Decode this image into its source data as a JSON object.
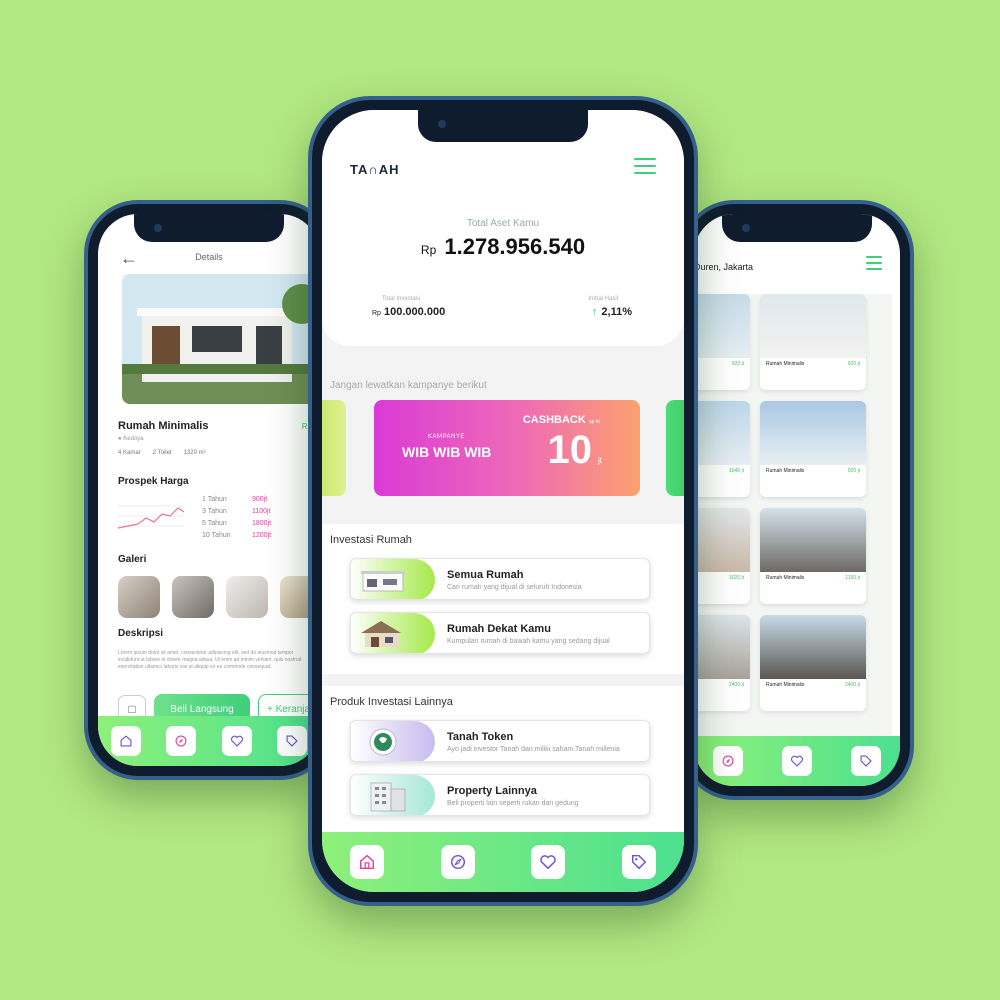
{
  "colors": {
    "background": "#b2e882",
    "accent_green": "#3fcf7a",
    "accent_pink": "#e73f9b",
    "tab_icon": "#6b4fe0"
  },
  "left": {
    "header_title": "Details",
    "property_name": "Rumah Minimalis",
    "price_partial": "Rp",
    "location": "Kedoya",
    "specs": [
      "4 Kamar",
      "2 Toilet",
      "1320 m²"
    ],
    "prospect_title": "Prospek Harga",
    "projection": [
      {
        "year": "1",
        "unit": "Tahun",
        "value": "900jt"
      },
      {
        "year": "3",
        "unit": "Tahun",
        "value": "1100jt"
      },
      {
        "year": "5",
        "unit": "Tahun",
        "value": "1800jt"
      },
      {
        "year": "10",
        "unit": "Tahun",
        "value": "1200jt"
      }
    ],
    "gallery_title": "Galeri",
    "description_title": "Deskripsi",
    "description_text": "Lorem ipsum dolor sit amet, consectetur adipiscing elit, sed do eiusmod tempor incididunt ut labore et dolore magna aliqua. Ut enim ad minim veniam, quis nostrud exercitation ullamco laboris nisi ut aliquip ex ea commodo consequat.",
    "buy_label": "Beli Langsung",
    "cart_label": "+ Keranjang"
  },
  "center": {
    "logo": "TA∩AH",
    "asset_label": "Total Aset Kamu",
    "asset_currency": "Rp",
    "asset_value": "1.278.956.540",
    "investment_label": "Total Investasi",
    "investment_currency": "Rp",
    "investment_value": "100.000.000",
    "return_label": "Imbal Hasil",
    "return_value": "2,11%",
    "campaign_prompt": "Jangan lewatkan kampanye berikut",
    "banner": {
      "kicker": "KAMPANYE",
      "title": "WIB WIB WIB",
      "cashback": "CASHBACK",
      "cashback_small": "up to",
      "amount": "10",
      "unit": "jt"
    },
    "invest_section_title": "Investasi Rumah",
    "invest_items": [
      {
        "title": "Semua Rumah",
        "subtitle": "Cari rumah yang dijual di seluruh Indonesia"
      },
      {
        "title": "Rumah Dekat Kamu",
        "subtitle": "Kumpulan rumah di bawah kamu yang sedang dijual"
      }
    ],
    "other_section_title": "Produk Investasi Lainnya",
    "other_items": [
      {
        "title": "Tanah Token",
        "subtitle": "Ayo jadi investor Tanah dan miliki saham Tanah millenia"
      },
      {
        "title": "Property Lainnya",
        "subtitle": "Beli properti lain seperti rukan dan gedung"
      }
    ]
  },
  "right": {
    "location": "Duren, Jakarta",
    "cards": [
      {
        "name": "",
        "price": "920 jt"
      },
      {
        "name": "Rumah Minimalis",
        "price": "920 jt"
      },
      {
        "name": "",
        "price": "1040 jt"
      },
      {
        "name": "Rumah Minimalis",
        "price": "920 jt"
      },
      {
        "name": "",
        "price": "1020 jt"
      },
      {
        "name": "Rumah Minimalis",
        "price": "1150 jt"
      },
      {
        "name": "",
        "price": "2400 jt"
      },
      {
        "name": "Rumah Minimalis",
        "price": "2400 jt"
      }
    ]
  }
}
